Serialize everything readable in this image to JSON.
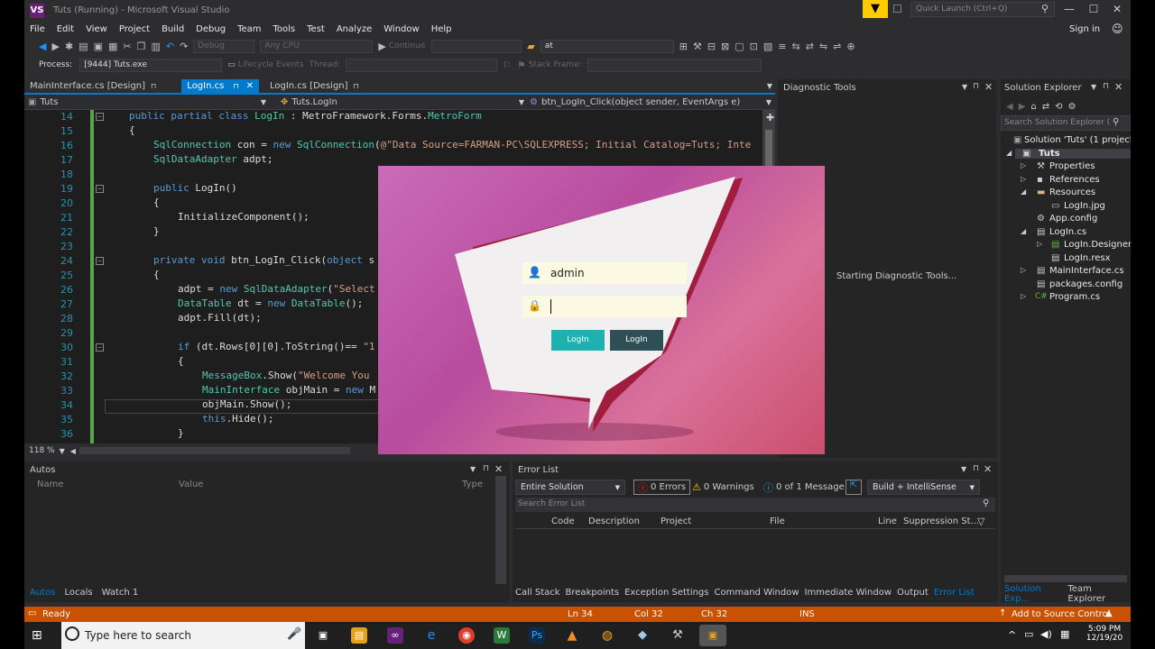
{
  "window": {
    "title": "Tuts (Running) - Microsoft Visual Studio",
    "quick_launch": "Quick Launch (Ctrl+Q)",
    "sign_in": "Sign in"
  },
  "menu": [
    "File",
    "Edit",
    "View",
    "Project",
    "Build",
    "Debug",
    "Team",
    "Tools",
    "Test",
    "Analyze",
    "Window",
    "Help"
  ],
  "toolbar": {
    "config": "Debug",
    "platform": "Any CPU",
    "continue": "Continue",
    "find": "at"
  },
  "toolbar2": {
    "process_label": "Process:",
    "process": "[9444] Tuts.exe",
    "lifecycle": "Lifecycle Events",
    "thread_label": "Thread:",
    "stack_frame": "Stack Frame:"
  },
  "tabs": [
    "MainInterface.cs [Design]",
    "LogIn.cs",
    "LogIn.cs [Design]"
  ],
  "nav": {
    "project": "Tuts",
    "class": "Tuts.LogIn",
    "member": "btn_LogIn_Click(object sender, EventArgs e)"
  },
  "editor": {
    "zoom": "118 %",
    "line_numbers": [
      "14",
      "15",
      "16",
      "17",
      "18",
      "19",
      "20",
      "21",
      "22",
      "23",
      "24",
      "25",
      "26",
      "27",
      "28",
      "29",
      "30",
      "31",
      "32",
      "33",
      "34",
      "35",
      "36"
    ]
  },
  "login_form": {
    "username": "admin",
    "button1": "LogIn",
    "button2": "LogIn"
  },
  "diagnostic": {
    "title": "Diagnostic Tools",
    "status": "Starting Diagnostic Tools..."
  },
  "solution_explorer": {
    "title": "Solution Explorer",
    "search": "Search Solution Explorer (",
    "items": [
      "Solution 'Tuts' (1 project)",
      "Tuts",
      "Properties",
      "References",
      "Resources",
      "LogIn.jpg",
      "App.config",
      "LogIn.cs",
      "LogIn.Designer.c",
      "LogIn.resx",
      "MainInterface.cs",
      "packages.config",
      "Program.cs"
    ]
  },
  "autos": {
    "title": "Autos",
    "col_name": "Name",
    "col_value": "Value",
    "col_type": "Type",
    "tabs": [
      "Autos",
      "Locals",
      "Watch 1"
    ]
  },
  "error_list": {
    "title": "Error List",
    "scope": "Entire Solution",
    "errors": "0 Errors",
    "warnings": "0 Warnings",
    "messages": "0 of 1 Message",
    "build": "Build + IntelliSense",
    "search": "Search Error List",
    "columns": [
      "Code",
      "Description",
      "Project",
      "File",
      "Line",
      "Suppression St..."
    ],
    "tabs": [
      "Call Stack",
      "Breakpoints",
      "Exception Settings",
      "Command Window",
      "Immediate Window",
      "Output",
      "Error List"
    ]
  },
  "se_tabs": [
    "Solution Exp...",
    "Team Explorer"
  ],
  "status": {
    "ready": "Ready",
    "ln": "Ln 34",
    "col": "Col 32",
    "ch": "Ch 32",
    "ins": "INS",
    "source_control": "Add to Source Control"
  },
  "taskbar": {
    "search": "Type here to search",
    "time": "5:09 PM",
    "date": "12/19/20"
  },
  "colors": {
    "accent": "#007acc",
    "status": "#ca5100",
    "teal_button": "#1fb0b0",
    "dark_button": "#2d4f55"
  }
}
